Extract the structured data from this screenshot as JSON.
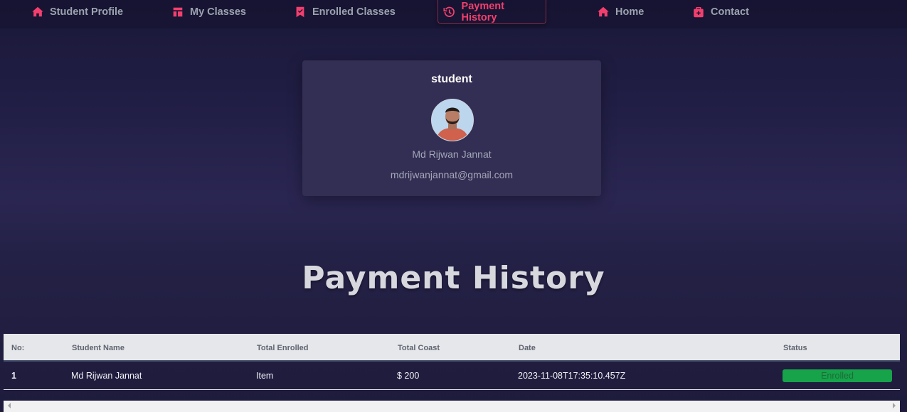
{
  "nav": {
    "items": [
      {
        "label": "Student Profile",
        "icon": "home-icon"
      },
      {
        "label": "My Classes",
        "icon": "layout-icon"
      },
      {
        "label": "Enrolled Classes",
        "icon": "bookmark-icon"
      },
      {
        "label": "Payment History",
        "icon": "history-icon",
        "active": true
      },
      {
        "label": "Home",
        "icon": "home-icon"
      },
      {
        "label": "Contact",
        "icon": "briefcase-medical-icon"
      }
    ]
  },
  "profile": {
    "role": "student",
    "name": "Md Rijwan Jannat",
    "email": "mdrijwanjannat@gmail.com"
  },
  "page": {
    "title": "Payment History"
  },
  "table": {
    "headers": [
      "No:",
      "Student Name",
      "Total Enrolled",
      "Total Coast",
      "Date",
      "Status"
    ],
    "rows": [
      {
        "no": "1",
        "name": "Md Rijwan Jannat",
        "enrolled": "Item",
        "cost": "$ 200",
        "date": "2023-11-08T17:35:10.457Z",
        "status": "Enrolled"
      }
    ]
  },
  "colors": {
    "accent": "#f43f6e",
    "status_enrolled": "#16a34a"
  }
}
